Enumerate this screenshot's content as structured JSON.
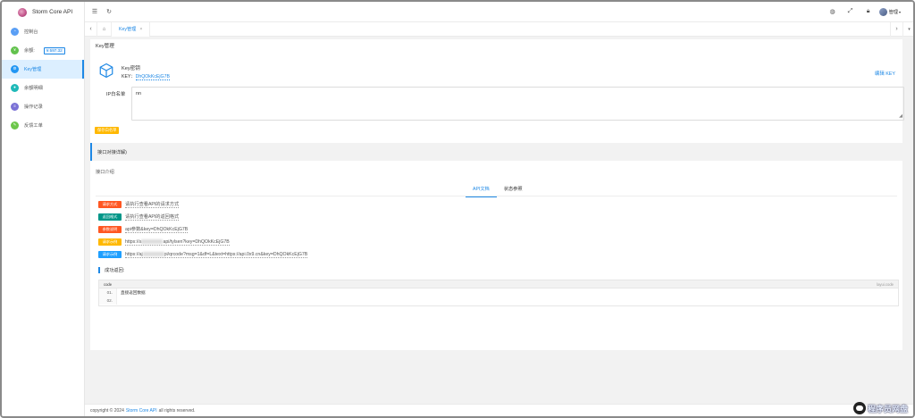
{
  "app": {
    "title": "Storm Core API"
  },
  "sidebar": {
    "items": [
      {
        "label": "控制台",
        "color": "#5a9ff5",
        "icon": "dashboard-icon"
      },
      {
        "label": "余额:",
        "balance": "¥ 597.32",
        "color": "#62c24d",
        "icon": "wallet-icon"
      },
      {
        "label": "Key管理",
        "color": "#2196f3",
        "icon": "key-icon"
      },
      {
        "label": "余额明细",
        "color": "#1fb9b8",
        "icon": "chat-icon"
      },
      {
        "label": "操作记录",
        "color": "#7b72d6",
        "icon": "log-icon"
      },
      {
        "label": "反馈工单",
        "color": "#6cc64a",
        "icon": "ticket-icon"
      }
    ]
  },
  "topbar": {
    "user": "管理",
    "icons": [
      "menu-icon",
      "refresh-icon",
      "globe-icon",
      "fullscreen-icon",
      "lock-icon"
    ]
  },
  "tabs": [
    {
      "label": "Key管理"
    }
  ],
  "page": {
    "title": "Key管理",
    "key_name": "Key密钥",
    "key_label": "KEY：",
    "key_value": "DhQOkKcEjG7B",
    "edit_key": "编辑 KEY",
    "ip_label": "IP白名单",
    "ip_value": "nn",
    "save_ip": "保存白名单",
    "section_title": "接口对接详解)",
    "intro": "接口介绍",
    "doc_tabs": [
      {
        "label": "API文档",
        "active": true
      },
      {
        "label": "状态参照",
        "active": false
      }
    ],
    "doc_rows": [
      {
        "tag": "请求方式",
        "color": "#ff5722",
        "text": "请执行查看API的请求方式"
      },
      {
        "tag": "返回格式",
        "color": "#009688",
        "text": "请执行查看API的返回格式"
      },
      {
        "tag": "参数说明",
        "color": "#ff5722",
        "text": "api参数&key=DhQOkKcEjG7B"
      },
      {
        "tag": "请求示例",
        "color": "#ffb800",
        "text_pre": "https://a",
        "text_post": "api/tylsen?key=DhQOkKcEjG7B"
      },
      {
        "tag": "请求示例",
        "color": "#1e9fff",
        "text_pre": "https://aj",
        "text_post": "pi/qrcode?msg=1&df=L&text=https://api.0x9.cn&key=DhQOkKcEjG7B"
      }
    ],
    "result_title": "成功返回:",
    "code_label": "code",
    "code_lang": "layui.code",
    "code_lines": [
      {
        "n": "01.",
        "t": "直接返回数据"
      },
      {
        "n": "02.",
        "t": ""
      }
    ]
  },
  "footer": {
    "pre": "copyright © 2024",
    "link": "Storm Core API",
    "post": "all rights reserved."
  },
  "watermark": {
    "text": "程序员网盘"
  }
}
